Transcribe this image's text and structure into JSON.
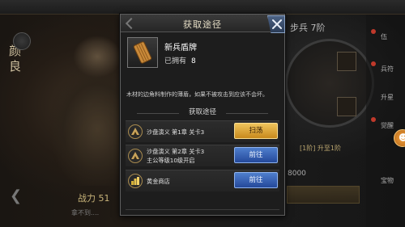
{
  "background": {
    "hero_name": "颜良",
    "power_label": "战力 51",
    "unit_title": "步兵 7阶",
    "level_text": "[1阶]  升至1阶",
    "cost_text": "8000",
    "side_labels": [
      "伍",
      "兵符",
      "升星",
      "觉醒",
      "宝物"
    ],
    "bottom_small_text": "拿不到...."
  },
  "dialog": {
    "title": "获取途径",
    "item": {
      "name": "新兵盾牌",
      "owned_label": "已拥有",
      "owned_count": "8",
      "icon": "shield-icon",
      "description": "木材的边角料制作的薄盾，如果不被攻击到应该不会坏。"
    },
    "sources_heading": "获取途径",
    "sources": [
      {
        "line1": "沙盘演义 第1章 关卡3",
        "line2": "",
        "button": "扫荡",
        "button_style": "sweep",
        "icon": "camp-icon"
      },
      {
        "line1": "沙盘演义 第2章 关卡3",
        "line2": "主公等级10级开启",
        "button": "前往",
        "button_style": "go",
        "icon": "camp-icon"
      },
      {
        "line1": "黄金商店",
        "line2": "",
        "button": "前往",
        "button_style": "go",
        "icon": "gold-shop-icon"
      }
    ]
  },
  "colors": {
    "sweep_button": "#e0a93a",
    "go_button": "#3a64b5",
    "close_button": "#3e5478"
  }
}
